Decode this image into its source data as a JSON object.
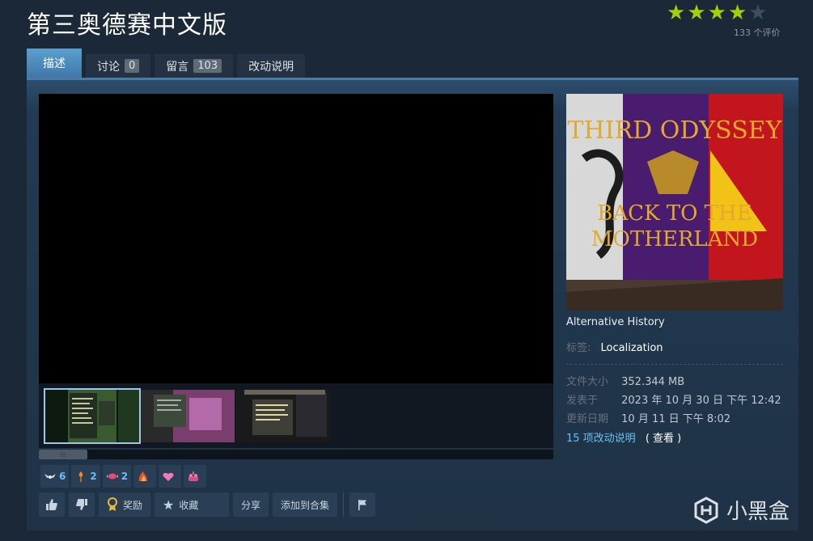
{
  "header": {
    "title": "第三奥德赛中文版",
    "rating_count": "133 个评价",
    "stars_filled": 4,
    "stars_total": 5
  },
  "tabs": [
    {
      "label": "描述",
      "count": ""
    },
    {
      "label": "讨论",
      "count": "0"
    },
    {
      "label": "留言",
      "count": "103"
    },
    {
      "label": "改动说明",
      "count": ""
    }
  ],
  "cover": {
    "line1": "THIRD ODYSSEY",
    "line2": "BACK TO THE",
    "line3": "MOTHERLAND"
  },
  "details": {
    "category": "Alternative History",
    "tags_label": "标签:",
    "tags_value": "Localization",
    "file_size_label": "文件大小",
    "file_size": "352.344 MB",
    "posted_label": "发表于",
    "posted": "2023 年 10 月 30 日 下午 12:42",
    "updated_label": "更新日期",
    "updated": "10 月 11 日 下午 8:02",
    "changes_link": "15 项改动说明",
    "view_label": "( 查看 )"
  },
  "awards": [
    {
      "icon": "wings-icon",
      "count": "6"
    },
    {
      "icon": "torch-icon",
      "count": "2"
    },
    {
      "icon": "candy-icon",
      "count": "2"
    },
    {
      "icon": "fire-cat-icon",
      "count": ""
    },
    {
      "icon": "heart-icon",
      "count": ""
    },
    {
      "icon": "cake-icon",
      "count": ""
    }
  ],
  "actions": {
    "award": "奖励",
    "favorite": "收藏",
    "share": "分享",
    "add_collection": "添加到合集"
  },
  "watermark": "小黑盒",
  "colors": {
    "accent": "#66c0f4",
    "star": "#a4d007",
    "background": "#1b2838"
  }
}
